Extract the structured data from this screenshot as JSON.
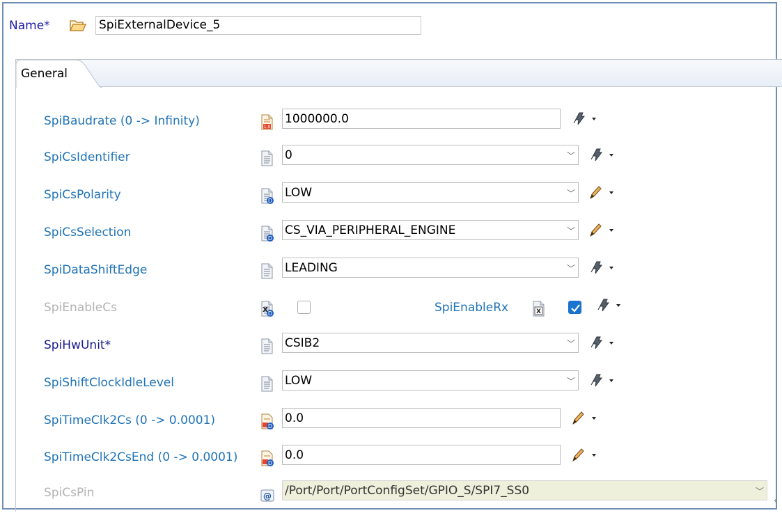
{
  "header": {
    "name_label": "Name*",
    "name_value": "SpiExternalDevice_5"
  },
  "tabs": [
    {
      "label": "General"
    }
  ],
  "params": [
    {
      "label": "SpiBaudrate (0 -> Infinity)",
      "value": "1000000.0",
      "type": "text",
      "icon": "float-param-icon",
      "tool": "gear-menu-icon"
    },
    {
      "label": "SpiCsIdentifier",
      "value": "0",
      "type": "combo",
      "icon": "doc-param-icon",
      "tool": "gear-menu-icon"
    },
    {
      "label": "SpiCsPolarity",
      "value": "LOW",
      "type": "combo",
      "icon": "derived-param-icon",
      "tool": "pencil-menu-icon"
    },
    {
      "label": "SpiCsSelection",
      "value": "CS_VIA_PERIPHERAL_ENGINE",
      "type": "combo",
      "icon": "derived-param-icon",
      "tool": "pencil-menu-icon"
    },
    {
      "label": "SpiDataShiftEdge",
      "value": "LEADING",
      "type": "combo",
      "icon": "doc-param-icon",
      "tool": "gear-menu-icon"
    },
    {
      "label": "SpiEnableCs",
      "type": "checkbox",
      "checked": false,
      "disabled": true,
      "icon": "bool-derived-param-icon"
    },
    {
      "label": "SpiEnableRx",
      "type": "checkbox",
      "checked": true,
      "icon": "bool-param-icon",
      "tool": "gear-menu-icon"
    },
    {
      "label": "SpiHwUnit*",
      "value": "CSIB2",
      "type": "combo",
      "icon": "doc-param-icon",
      "tool": "gear-menu-icon"
    },
    {
      "label": "SpiShiftClockIdleLevel",
      "value": "LOW",
      "type": "combo",
      "icon": "doc-param-icon",
      "tool": "gear-menu-icon"
    },
    {
      "label": "SpiTimeClk2Cs (0 -> 0.0001)",
      "value": "0.0",
      "type": "text",
      "icon": "float-derived-param-icon",
      "tool": "pencil-menu-icon"
    },
    {
      "label": "SpiTimeClk2CsEnd (0 -> 0.0001)",
      "value": "0.0",
      "type": "text",
      "icon": "float-derived-param-icon",
      "tool": "pencil-menu-icon"
    },
    {
      "label": "SpiCsPin",
      "value": "/Port/Port/PortConfigSet/GPIO_S/SPI7_SS0",
      "type": "reference",
      "disabled": true,
      "icon": "reference-param-icon"
    }
  ],
  "colors": {
    "label_blue": "#1f73b7",
    "label_dark": "#1a1a8c",
    "label_disabled": "#b3b3b3",
    "frame_border": "#6e8fb7",
    "checkbox_checked": "#1a73d0",
    "readonly_field_bg": "#eef0db"
  },
  "edge_glyph": "‹"
}
